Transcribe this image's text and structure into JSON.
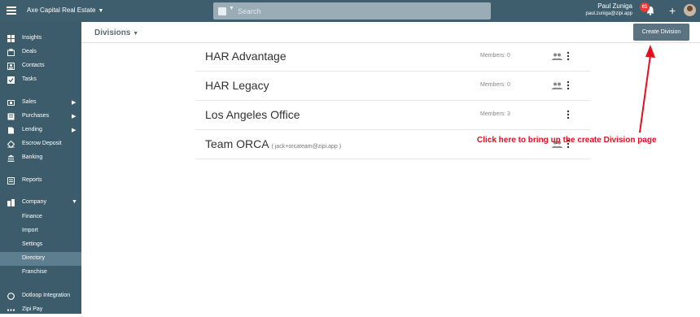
{
  "topbar": {
    "company_name": "Axe Capital Real Estate",
    "search_placeholder": "Search",
    "user_name": "Paul Zuniga",
    "user_email": "paul.zuniga@zipi.app",
    "notification_count": "61"
  },
  "sidebar": {
    "items": [
      {
        "label": "Insights",
        "icon": "insights-icon"
      },
      {
        "label": "Deals",
        "icon": "deals-icon"
      },
      {
        "label": "Contacts",
        "icon": "contacts-icon"
      },
      {
        "label": "Tasks",
        "icon": "tasks-icon"
      },
      {
        "label": "Sales",
        "icon": "sales-icon"
      },
      {
        "label": "Purchases",
        "icon": "purchases-icon"
      },
      {
        "label": "Lending",
        "icon": "lending-icon"
      },
      {
        "label": "Escrow Deposit",
        "icon": "escrow-icon"
      },
      {
        "label": "Banking",
        "icon": "bank-icon"
      },
      {
        "label": "Reports",
        "icon": "reports-icon"
      },
      {
        "label": "Company",
        "icon": "company-icon"
      },
      {
        "label": "Finance"
      },
      {
        "label": "Import"
      },
      {
        "label": "Settings"
      },
      {
        "label": "Directory"
      },
      {
        "label": "Franchise"
      },
      {
        "label": "Dotloop Integration",
        "icon": "dotloop-icon"
      },
      {
        "label": "Zipi Pay",
        "icon": "zipi-pay-icon"
      }
    ]
  },
  "page": {
    "title": "Divisions",
    "create_button": "Create Division"
  },
  "divisions": [
    {
      "name": "HAR Advantage",
      "sub": "",
      "members": "Members: 0"
    },
    {
      "name": "HAR Legacy",
      "sub": "",
      "members": "Members: 0"
    },
    {
      "name": "Los Angeles Office",
      "sub": "",
      "members": "Members: 3"
    },
    {
      "name": "Team ORCA",
      "sub": "( jack+orcateam@zipi.app )",
      "members": ""
    }
  ],
  "annotation": {
    "text": "Click here to bring up the create Division page",
    "color": "#e5101e"
  },
  "colors": {
    "topbar": "#3e5e6e",
    "sidebar": "#3c5c6c",
    "sidebar_active": "#5d7e8e",
    "button": "#5b7380"
  }
}
